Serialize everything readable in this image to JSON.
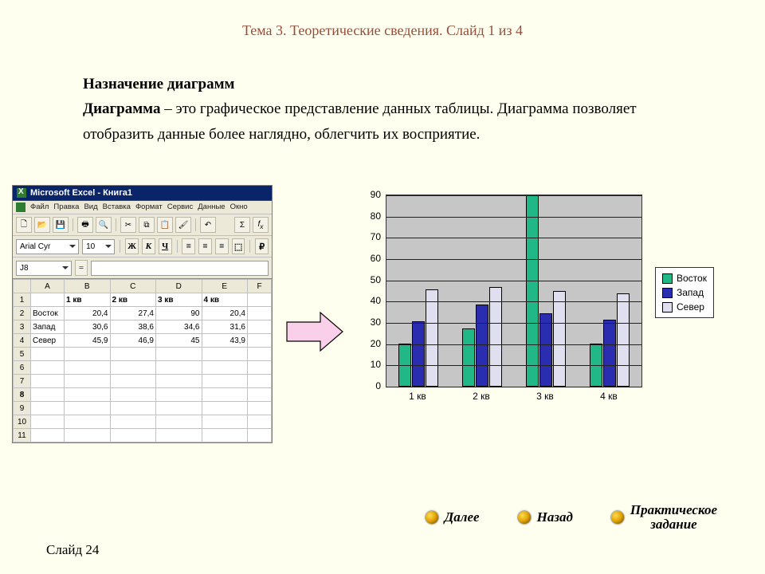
{
  "breadcrumb": "Тема 3. Теоретические сведения. Слайд 1 из 4",
  "heading": "Назначение диаграмм",
  "def_term": "Диаграмма",
  "def_rest": " – это графическое представление данных таблицы. Диаграмма позволяет отобразить данные более наглядно, облегчить их восприятие.",
  "excel": {
    "title": "Microsoft Excel - Книга1",
    "menus": [
      "Файл",
      "Правка",
      "Вид",
      "Вставка",
      "Формат",
      "Сервис",
      "Данные",
      "Окно"
    ],
    "font_name": "Arial Cyr",
    "font_size": "10",
    "bold": "Ж",
    "italic": "К",
    "underline": "Ч",
    "name_box": "J8",
    "formula_prefix": "=",
    "col_headers": [
      "",
      "A",
      "B",
      "C",
      "D",
      "E",
      "F"
    ],
    "row_labels": [
      "",
      "1 кв",
      "2 кв",
      "3 кв",
      "4 кв"
    ],
    "rows": [
      {
        "n": "1",
        "label": "",
        "cells": [
          "1 кв",
          "2 кв",
          "3 кв",
          "4 кв",
          ""
        ]
      },
      {
        "n": "2",
        "label": "Восток",
        "cells": [
          "20,4",
          "27,4",
          "90",
          "20,4",
          ""
        ]
      },
      {
        "n": "3",
        "label": "Запад",
        "cells": [
          "30,6",
          "38,6",
          "34,6",
          "31,6",
          ""
        ]
      },
      {
        "n": "4",
        "label": "Север",
        "cells": [
          "45,9",
          "46,9",
          "45",
          "43,9",
          ""
        ]
      },
      {
        "n": "5",
        "label": "",
        "cells": [
          "",
          "",
          "",
          "",
          ""
        ]
      },
      {
        "n": "6",
        "label": "",
        "cells": [
          "",
          "",
          "",
          "",
          ""
        ]
      },
      {
        "n": "7",
        "label": "",
        "cells": [
          "",
          "",
          "",
          "",
          ""
        ]
      },
      {
        "n": "8",
        "label": "",
        "cells": [
          "",
          "",
          "",
          "",
          ""
        ]
      },
      {
        "n": "9",
        "label": "",
        "cells": [
          "",
          "",
          "",
          "",
          ""
        ]
      },
      {
        "n": "10",
        "label": "",
        "cells": [
          "",
          "",
          "",
          "",
          ""
        ]
      },
      {
        "n": "11",
        "label": "",
        "cells": [
          "",
          "",
          "",
          "",
          ""
        ]
      }
    ]
  },
  "chart_data": {
    "type": "bar",
    "categories": [
      "1 кв",
      "2 кв",
      "3 кв",
      "4 кв"
    ],
    "series": [
      {
        "name": "Восток",
        "values": [
          20.4,
          27.4,
          90,
          20.4
        ]
      },
      {
        "name": "Запад",
        "values": [
          30.6,
          38.6,
          34.6,
          31.6
        ]
      },
      {
        "name": "Север",
        "values": [
          45.9,
          46.9,
          45,
          43.9
        ]
      }
    ],
    "ylim": [
      0,
      90
    ],
    "yticks": [
      0,
      10,
      20,
      30,
      40,
      50,
      60,
      70,
      80,
      90
    ]
  },
  "nav": {
    "next": "Далее",
    "back": "Назад",
    "practice_l1": "Практическое",
    "practice_l2": "задание"
  },
  "footer": "Слайд 24"
}
